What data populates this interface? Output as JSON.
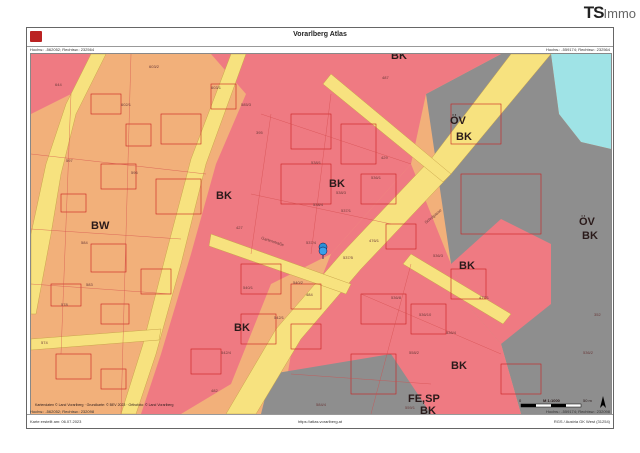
{
  "brand": {
    "ts": "TS",
    "immo": "Immo"
  },
  "header": {
    "title": "Vorarlberg Atlas",
    "coord_left": "Hochw.: -562052; Rechtsw.: 232564",
    "coord_right": "Hochw.: -559174; Rechtsw.: 232564"
  },
  "map": {
    "zones": [
      "BK",
      "BK",
      "BW",
      "BK",
      "BK",
      "BK",
      "BK",
      "ÖV",
      "BK",
      "ÖV",
      "BK",
      "FE,SP",
      "BK"
    ],
    "parcels": [
      "644",
      "603/2",
      "602/1",
      "603/1",
      "598",
      "602/3",
      "596",
      "597",
      "599",
      "584",
      "583",
      "578",
      "576",
      "575/1",
      "586",
      "587/1",
      "574",
      "590/2",
      "580/1",
      "575",
      "589",
      "587",
      "720",
      "585/1",
      "585/3",
      "582/1",
      "582",
      "591",
      "592",
      "593",
      "395",
      "396",
      "427",
      "429",
      "538/1",
      "538/3",
      "538/4",
      "538/2",
      "537/1",
      "537/3",
      "537/4",
      "537/5",
      "536/1",
      "536/2",
      "430",
      "476/1",
      "540/1",
      "540/2",
      "540/3",
      "542/1",
      "542/3",
      "542/4",
      "542/2",
      "484",
      "485",
      "486",
      "482",
      "483",
      "536/3",
      "536/7",
      "536/8",
      "536/6",
      "536/10",
      "536/4",
      "477/1",
      "537/2",
      "536/5",
      "558/2",
      "559/1",
      "584/4",
      "559/2",
      "487",
      "486",
      "352",
      "536/2",
      "429"
    ],
    "street_labels": [
      "Gartenstraße",
      "Schulgasse",
      "Schwefel",
      "Amtsgasse",
      "Kronenstraße"
    ],
    "scale": {
      "label": "M 1:1000",
      "zero": "0",
      "end": "50 m"
    },
    "copyright": "Kartendaten © Land Vorarlberg · Grundkarte: © BEV 2023 · Orthofoto: © Land Vorarlberg"
  },
  "footer": {
    "left": "Hochw.: -562052; Rechtsw.: 232098",
    "left_2": "Karte erstellt am: 06.07.2023",
    "center": "https://atlas.vorarlberg.at",
    "right": "Hochw.: -559174; Rechtsw.: 232098",
    "right_2": "RGS / Austria GK West (31254)"
  },
  "colors": {
    "bk": "#ef7a82",
    "bw": "#f2b07a",
    "ov": "#8e8e8e",
    "road": "#f7e27f",
    "water": "#9fe3e6"
  }
}
